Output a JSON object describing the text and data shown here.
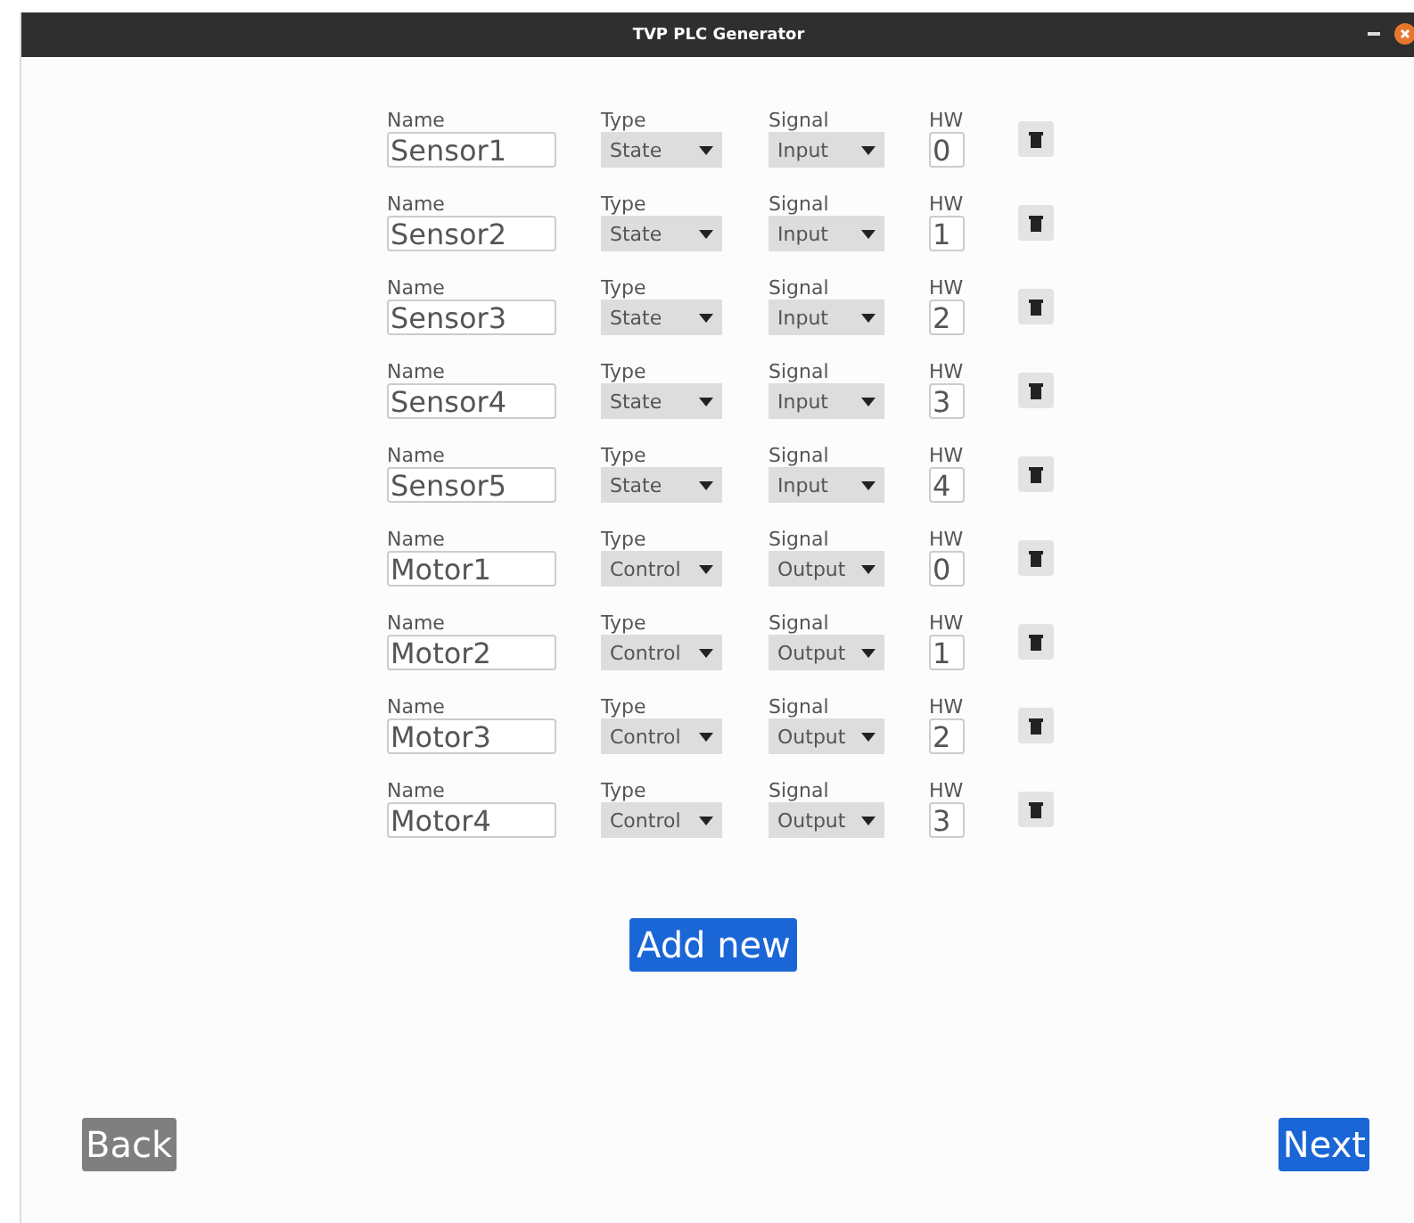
{
  "window": {
    "title": "TVP PLC Generator"
  },
  "rows": [
    {
      "name_label": "Name",
      "name": "Sensor1",
      "type_label": "Type",
      "type": "State",
      "signal_label": "Signal",
      "signal": "Input",
      "hw_label": "HW",
      "hw": "0"
    },
    {
      "name_label": "Name",
      "name": "Sensor2",
      "type_label": "Type",
      "type": "State",
      "signal_label": "Signal",
      "signal": "Input",
      "hw_label": "HW",
      "hw": "1"
    },
    {
      "name_label": "Name",
      "name": "Sensor3",
      "type_label": "Type",
      "type": "State",
      "signal_label": "Signal",
      "signal": "Input",
      "hw_label": "HW",
      "hw": "2"
    },
    {
      "name_label": "Name",
      "name": "Sensor4",
      "type_label": "Type",
      "type": "State",
      "signal_label": "Signal",
      "signal": "Input",
      "hw_label": "HW",
      "hw": "3"
    },
    {
      "name_label": "Name",
      "name": "Sensor5",
      "type_label": "Type",
      "type": "State",
      "signal_label": "Signal",
      "signal": "Input",
      "hw_label": "HW",
      "hw": "4"
    },
    {
      "name_label": "Name",
      "name": "Motor1",
      "type_label": "Type",
      "type": "Control",
      "signal_label": "Signal",
      "signal": "Output",
      "hw_label": "HW",
      "hw": "0"
    },
    {
      "name_label": "Name",
      "name": "Motor2",
      "type_label": "Type",
      "type": "Control",
      "signal_label": "Signal",
      "signal": "Output",
      "hw_label": "HW",
      "hw": "1"
    },
    {
      "name_label": "Name",
      "name": "Motor3",
      "type_label": "Type",
      "type": "Control",
      "signal_label": "Signal",
      "signal": "Output",
      "hw_label": "HW",
      "hw": "2"
    },
    {
      "name_label": "Name",
      "name": "Motor4",
      "type_label": "Type",
      "type": "Control",
      "signal_label": "Signal",
      "signal": "Output",
      "hw_label": "HW",
      "hw": "3"
    }
  ],
  "add_button": "Add new",
  "back_button": "Back",
  "next_button": "Next"
}
